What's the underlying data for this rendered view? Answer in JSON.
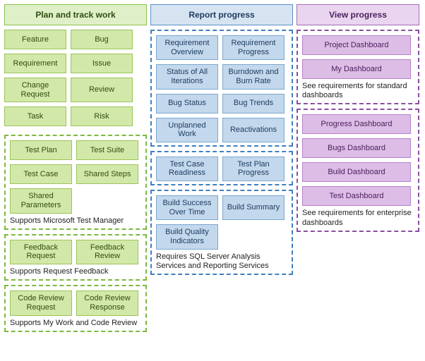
{
  "columns": {
    "plan": {
      "title": "Plan and track work"
    },
    "report": {
      "title": "Report progress"
    },
    "view": {
      "title": "View progress"
    }
  },
  "plan": {
    "work_items": [
      "Feature",
      "Bug",
      "Requirement",
      "Issue",
      "Change Request",
      "Review",
      "Task",
      "Risk"
    ],
    "test_items": [
      "Test Plan",
      "Test Suite",
      "Test Case",
      "Shared Steps",
      "Shared Parameters"
    ],
    "test_caption": "Supports Microsoft Test Manager",
    "feedback_items": [
      "Feedback Request",
      "Feedback Review"
    ],
    "feedback_caption": "Supports Request Feedback",
    "codereview_items": [
      "Code Review Request",
      "Code Review Response"
    ],
    "codereview_caption": "Supports My Work and Code Review"
  },
  "report": {
    "req_items": [
      "Requirement Overview",
      "Requirement Progress",
      "Status of All Iterations",
      "Burndown and Burn Rate",
      "Bug Status",
      "Bug Trends",
      "Unplanned Work",
      "Reactivations"
    ],
    "test_items": [
      "Test Case Readiness",
      "Test Plan Progress"
    ],
    "build_items": [
      "Build Success Over Time",
      "Build Summary",
      "Build Quality Indicators"
    ],
    "build_caption": "Requires SQL Server Analysis Services and Reporting Services"
  },
  "view": {
    "standard_items": [
      "Project Dashboard",
      "My Dashboard"
    ],
    "standard_caption": "See requirements for standard dashboards",
    "enterprise_items": [
      "Progress Dashboard",
      "Bugs Dashboard",
      "Build Dashboard",
      "Test Dashboard"
    ],
    "enterprise_caption": "See requirements for enterprise dashboards"
  }
}
